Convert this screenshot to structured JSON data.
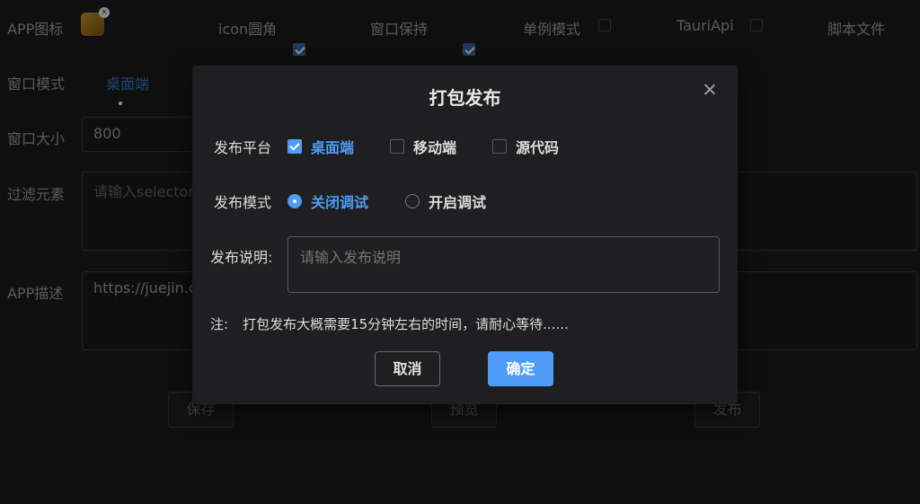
{
  "background": {
    "row1": {
      "app_icon_label": "APP图标",
      "icon_round_label": "icon圆角",
      "window_keep_label": "窗口保持",
      "single_mode_label": "单例模式",
      "tauri_api_label": "TauriApi",
      "script_file_label": "脚本文件"
    },
    "window_mode_label": "窗口模式",
    "window_mode_option": "桌面端",
    "window_size_label": "窗口大小",
    "window_size_value": "800",
    "filter_label": "过滤元素",
    "filter_placeholder": "请输入selector",
    "app_desc_label": "APP描述",
    "app_desc_value": "https://juejin.c",
    "buttons": {
      "save": "保存",
      "preview": "预览",
      "publish": "发布"
    }
  },
  "dialog": {
    "title": "打包发布",
    "platform_label": "发布平台",
    "platforms": [
      {
        "label": "桌面端",
        "checked": true
      },
      {
        "label": "移动端",
        "checked": false
      },
      {
        "label": "源代码",
        "checked": false
      }
    ],
    "mode_label": "发布模式",
    "modes": [
      {
        "label": "关闭调试",
        "selected": true
      },
      {
        "label": "开启调试",
        "selected": false
      }
    ],
    "desc_label": "发布说明:",
    "desc_placeholder": "请输入发布说明",
    "note_prefix": "注:",
    "note_text": "打包发布大概需要15分钟左右的时间，请耐心等待......",
    "cancel": "取消",
    "confirm": "确定"
  },
  "colors": {
    "accent": "#4f9cf6",
    "dialog_bg": "#1f1f21",
    "page_bg": "#18181a"
  }
}
